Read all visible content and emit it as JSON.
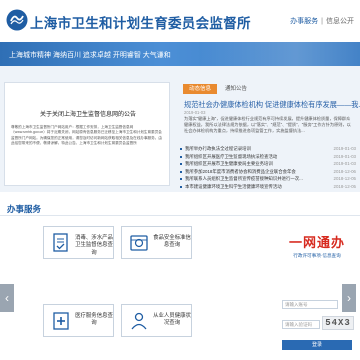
{
  "header": {
    "site_title": "上海市卫生和计划生育委员会监督所",
    "link_services": "办事服务",
    "link_disclosure": "信息公开",
    "separator": "|"
  },
  "banner": {
    "slogan": "上海城市精神 海纳百川 追求卓越 开明睿智 大气谦和"
  },
  "notice": {
    "title": "关于关闭上海卫生监督信息网的公告",
    "body": "尊敬的上海市卫生监督所门户网站用户：根据工作安排，上海卫生监督信息网（www.smhb.gov.cn）将于近期关闭，网站原有信息服务已迁移至上海市卫生和计划生育委员会监督所门户网站。为确保您的正常使用，请您及时访问新网站获取相关信息及在线办事服务。由此给您带来的不便，敬请谅解。特此公告。上海市卫生和计划生育委员会监督所"
  },
  "tabs": [
    {
      "label": "动态信息",
      "active": true
    },
    {
      "label": "通知公告",
      "active": false
    }
  ],
  "headline": {
    "title": "规范社会办健康体检机构 促进健康体检有序发展——我...",
    "date": "2019-01-03",
    "summary": "为落实\"健康上海\"，促进健康体检行业规范有序可持续发展，提升健康体检质量，保障群众健康权益，我所以法律法规为依据，以\"落实\"、\"规范\"、\"提质\"、\"服务\"工作方针为原则，以社会办体检机构为重点，持续推进各项监管工作，实施监督执法..."
  },
  "news": [
    {
      "title": "我所举办行政执法全过程记录培训",
      "date": "2019-01-03"
    },
    {
      "title": "我所组织区开展医疗卫生监督现场执法检查活动",
      "date": "2019-01-03"
    },
    {
      "title": "我所组织区开展市卫生健康委局主要业务培训",
      "date": "2019-01-03"
    },
    {
      "title": "我所参加2018年度市消费者协会和消费品企业联合会年会",
      "date": "2018-12-06"
    },
    {
      "title": "我所联系人员组织卫生监督所宣传疫苗接种知识并进行一次...",
      "date": "2018-12-05"
    },
    {
      "title": "本市建设健康环境卫生科学生活健康环境宣传活动",
      "date": "2018-12-05"
    }
  ],
  "services": {
    "heading": "办事服务",
    "items": [
      {
        "label": "消毒、涉水产品卫生监督信息查询",
        "icon": "document-check-icon"
      },
      {
        "label": "食品安全标准信息查询",
        "icon": "food-standard-icon"
      },
      {
        "label": "医疗服务信息查询",
        "icon": "medical-service-icon"
      },
      {
        "label": "从业人员健康状况查询",
        "icon": "person-health-icon"
      }
    ],
    "prev": "‹",
    "next": "›"
  },
  "guide": {
    "banner_text": "一网通办",
    "subtitle": "行政许可事项·信息查询"
  },
  "login": {
    "account_label": "",
    "account_placeholder": "请输入账号",
    "code_label": "",
    "code_placeholder": "请输入验证码",
    "captcha": "54X3",
    "button": "登录"
  },
  "colors": {
    "brand_blue": "#1f5da3",
    "tab_orange": "#e98a2f",
    "guide_red": "#d72a1f"
  }
}
